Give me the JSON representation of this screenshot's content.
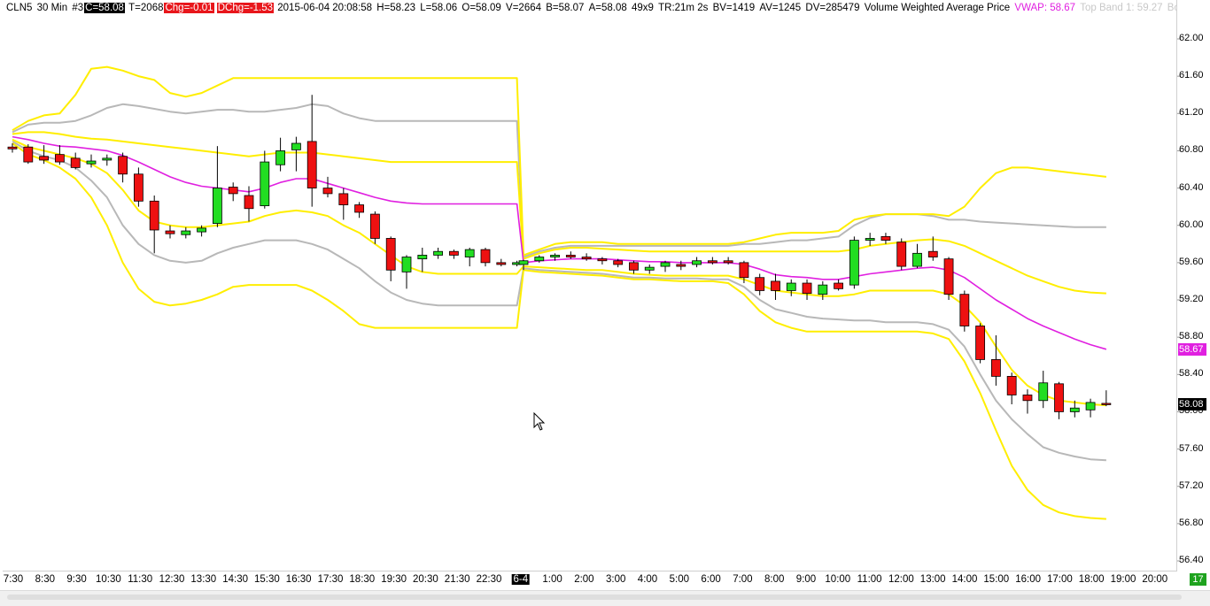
{
  "header": {
    "symbol": "CLN5",
    "interval": "30 Min",
    "instance": "#3",
    "close": "C=58.08",
    "trades": "T=2068",
    "change": "Chg=-0.01",
    "day_change": "DChg=-1.53",
    "timestamp": "2015-06-04 20:08:58",
    "high": "H=58.23",
    "low": "L=58.06",
    "open": "O=58.09",
    "volume": "V=2664",
    "bid": "B=58.07",
    "ask": "A=58.08",
    "bidask_size": "49x9",
    "time_range": "TR:21m 2s",
    "bid_volume": "BV=1419",
    "ask_volume": "AV=1245",
    "delta_volume": "DV=285479",
    "study_name": "Volume Weighted Average Price",
    "vwap": "VWAP: 58.67",
    "top_band": "Top Band 1: 59.27",
    "bottom_band": "Bottom"
  },
  "colors": {
    "up": "#22dd22",
    "down": "#ee1111",
    "vwap": "#e020e0",
    "band_yellow": "#ffee00",
    "band_gray": "#b8b8b8",
    "price_badge": "#000000",
    "vwap_badge": "#e020e0"
  },
  "chart_data": {
    "type": "candlestick",
    "title": "",
    "ylim": [
      56.3,
      62.15
    ],
    "y_ticks": [
      "62.00",
      "61.60",
      "61.20",
      "60.80",
      "60.40",
      "60.00",
      "59.60",
      "59.20",
      "58.80",
      "58.40",
      "58.00",
      "57.60",
      "57.20",
      "56.80",
      "56.40"
    ],
    "x_ticks": [
      "7:30",
      "8:30",
      "9:30",
      "10:30",
      "11:30",
      "12:30",
      "13:30",
      "14:30",
      "15:30",
      "16:30",
      "17:30",
      "18:30",
      "19:30",
      "20:30",
      "21:30",
      "22:30",
      "6-4",
      "1:00",
      "2:00",
      "3:00",
      "4:00",
      "5:00",
      "6:00",
      "7:00",
      "8:00",
      "9:00",
      "10:00",
      "11:00",
      "12:00",
      "13:00",
      "14:00",
      "15:00",
      "16:00",
      "17:00",
      "18:00",
      "19:00",
      "20:00"
    ],
    "date_tick": "6-4",
    "last_price_label": "58.08",
    "vwap_label": "58.67",
    "corner_label": "17",
    "candles": {
      "session1": [
        {
          "o": 60.84,
          "h": 60.88,
          "l": 60.78,
          "c": 60.82
        },
        {
          "o": 60.84,
          "h": 60.87,
          "l": 60.66,
          "c": 60.68
        },
        {
          "o": 60.74,
          "h": 60.86,
          "l": 60.66,
          "c": 60.7
        },
        {
          "o": 60.76,
          "h": 60.86,
          "l": 60.65,
          "c": 60.68
        },
        {
          "o": 60.72,
          "h": 60.78,
          "l": 60.6,
          "c": 60.62
        },
        {
          "o": 60.66,
          "h": 60.76,
          "l": 60.62,
          "c": 60.69
        },
        {
          "o": 60.7,
          "h": 60.76,
          "l": 60.64,
          "c": 60.72
        },
        {
          "o": 60.74,
          "h": 60.78,
          "l": 60.46,
          "c": 60.55
        },
        {
          "o": 60.55,
          "h": 60.62,
          "l": 60.2,
          "c": 60.26
        },
        {
          "o": 60.26,
          "h": 60.32,
          "l": 59.7,
          "c": 59.95
        },
        {
          "o": 59.94,
          "h": 60.0,
          "l": 59.86,
          "c": 59.91
        },
        {
          "o": 59.9,
          "h": 59.98,
          "l": 59.86,
          "c": 59.94
        },
        {
          "o": 59.93,
          "h": 60.0,
          "l": 59.88,
          "c": 59.97
        },
        {
          "o": 60.02,
          "h": 60.85,
          "l": 59.98,
          "c": 60.4
        },
        {
          "o": 60.41,
          "h": 60.46,
          "l": 60.26,
          "c": 60.34
        },
        {
          "o": 60.32,
          "h": 60.42,
          "l": 60.04,
          "c": 60.18
        },
        {
          "o": 60.21,
          "h": 60.8,
          "l": 60.18,
          "c": 60.68
        },
        {
          "o": 60.65,
          "h": 60.94,
          "l": 60.58,
          "c": 60.8
        },
        {
          "o": 60.81,
          "h": 60.95,
          "l": 60.58,
          "c": 60.88
        },
        {
          "o": 60.9,
          "h": 61.4,
          "l": 60.2,
          "c": 60.4
        },
        {
          "o": 60.4,
          "h": 60.52,
          "l": 60.3,
          "c": 60.34
        },
        {
          "o": 60.34,
          "h": 60.4,
          "l": 60.06,
          "c": 60.22
        },
        {
          "o": 60.22,
          "h": 60.25,
          "l": 60.08,
          "c": 60.14
        },
        {
          "o": 60.12,
          "h": 60.15,
          "l": 59.8,
          "c": 59.86
        },
        {
          "o": 59.86,
          "h": 59.88,
          "l": 59.4,
          "c": 59.52
        },
        {
          "o": 59.5,
          "h": 59.68,
          "l": 59.32,
          "c": 59.66
        },
        {
          "o": 59.64,
          "h": 59.76,
          "l": 59.5,
          "c": 59.68
        },
        {
          "o": 59.68,
          "h": 59.76,
          "l": 59.64,
          "c": 59.72
        },
        {
          "o": 59.72,
          "h": 59.74,
          "l": 59.64,
          "c": 59.68
        },
        {
          "o": 59.66,
          "h": 59.76,
          "l": 59.56,
          "c": 59.74
        },
        {
          "o": 59.74,
          "h": 59.76,
          "l": 59.56,
          "c": 59.6
        },
        {
          "o": 59.6,
          "h": 59.64,
          "l": 59.56,
          "c": 59.58
        },
        {
          "o": 59.58,
          "h": 59.62,
          "l": 59.56,
          "c": 59.6
        }
      ],
      "session2": [
        {
          "o": 59.58,
          "h": 59.63,
          "l": 59.52,
          "c": 59.62
        },
        {
          "o": 59.62,
          "h": 59.68,
          "l": 59.6,
          "c": 59.66
        },
        {
          "o": 59.66,
          "h": 59.7,
          "l": 59.62,
          "c": 59.68
        },
        {
          "o": 59.68,
          "h": 59.72,
          "l": 59.64,
          "c": 59.66
        },
        {
          "o": 59.66,
          "h": 59.7,
          "l": 59.62,
          "c": 59.64
        },
        {
          "o": 59.64,
          "h": 59.66,
          "l": 59.58,
          "c": 59.62
        },
        {
          "o": 59.62,
          "h": 59.64,
          "l": 59.55,
          "c": 59.58
        },
        {
          "o": 59.6,
          "h": 59.62,
          "l": 59.48,
          "c": 59.52
        },
        {
          "o": 59.52,
          "h": 59.58,
          "l": 59.48,
          "c": 59.55
        },
        {
          "o": 59.56,
          "h": 59.62,
          "l": 59.5,
          "c": 59.6
        },
        {
          "o": 59.58,
          "h": 59.62,
          "l": 59.52,
          "c": 59.56
        },
        {
          "o": 59.58,
          "h": 59.66,
          "l": 59.55,
          "c": 59.62
        },
        {
          "o": 59.62,
          "h": 59.66,
          "l": 59.58,
          "c": 59.6
        },
        {
          "o": 59.62,
          "h": 59.66,
          "l": 59.58,
          "c": 59.6
        },
        {
          "o": 59.6,
          "h": 59.62,
          "l": 59.38,
          "c": 59.44
        },
        {
          "o": 59.44,
          "h": 59.48,
          "l": 59.25,
          "c": 59.3
        },
        {
          "o": 59.4,
          "h": 59.48,
          "l": 59.2,
          "c": 59.3
        },
        {
          "o": 59.3,
          "h": 59.42,
          "l": 59.24,
          "c": 59.38
        },
        {
          "o": 59.38,
          "h": 59.42,
          "l": 59.2,
          "c": 59.27
        },
        {
          "o": 59.26,
          "h": 59.4,
          "l": 59.2,
          "c": 59.36
        },
        {
          "o": 59.38,
          "h": 59.42,
          "l": 59.3,
          "c": 59.32
        },
        {
          "o": 59.36,
          "h": 59.88,
          "l": 59.32,
          "c": 59.84
        },
        {
          "o": 59.84,
          "h": 59.92,
          "l": 59.78,
          "c": 59.86
        },
        {
          "o": 59.88,
          "h": 59.92,
          "l": 59.8,
          "c": 59.84
        },
        {
          "o": 59.82,
          "h": 59.86,
          "l": 59.52,
          "c": 59.56
        },
        {
          "o": 59.56,
          "h": 59.8,
          "l": 59.54,
          "c": 59.7
        },
        {
          "o": 59.72,
          "h": 59.88,
          "l": 59.62,
          "c": 59.66
        },
        {
          "o": 59.64,
          "h": 59.66,
          "l": 59.2,
          "c": 59.26
        },
        {
          "o": 59.26,
          "h": 59.3,
          "l": 58.86,
          "c": 58.92
        },
        {
          "o": 58.92,
          "h": 58.95,
          "l": 58.52,
          "c": 58.56
        },
        {
          "o": 58.56,
          "h": 58.82,
          "l": 58.28,
          "c": 58.38
        },
        {
          "o": 58.38,
          "h": 58.42,
          "l": 58.08,
          "c": 58.18
        },
        {
          "o": 58.18,
          "h": 58.24,
          "l": 57.98,
          "c": 58.12
        },
        {
          "o": 58.12,
          "h": 58.44,
          "l": 58.04,
          "c": 58.31
        },
        {
          "o": 58.3,
          "h": 58.32,
          "l": 57.92,
          "c": 58.0
        },
        {
          "o": 58.0,
          "h": 58.12,
          "l": 57.94,
          "c": 58.04
        },
        {
          "o": 58.02,
          "h": 58.14,
          "l": 57.94,
          "c": 58.1
        },
        {
          "o": 58.09,
          "h": 58.23,
          "l": 58.06,
          "c": 58.08
        }
      ]
    },
    "series": [
      {
        "name": "VWAP",
        "session1": [
          60.95,
          60.92,
          60.88,
          60.85,
          60.84,
          60.82,
          60.8,
          60.75,
          60.68,
          60.6,
          60.52,
          60.46,
          60.42,
          60.4,
          60.38,
          60.36,
          60.4,
          60.46,
          60.5,
          60.5,
          60.45,
          60.4,
          60.35,
          60.3,
          60.26,
          60.24,
          60.23,
          60.23,
          60.23,
          60.23,
          60.23,
          60.23,
          60.23
        ],
        "session2": [
          59.6,
          59.62,
          59.63,
          59.64,
          59.64,
          59.64,
          59.63,
          59.62,
          59.61,
          59.61,
          59.6,
          59.6,
          59.6,
          59.6,
          59.58,
          59.53,
          59.47,
          59.45,
          59.44,
          59.42,
          59.42,
          59.45,
          59.48,
          59.5,
          59.52,
          59.54,
          59.55,
          59.52,
          59.44,
          59.32,
          59.2,
          59.1,
          59.0,
          58.92,
          58.85,
          58.78,
          58.72,
          58.67
        ]
      },
      {
        "name": "Top Band 1",
        "session1": [
          60.98,
          61.0,
          61.0,
          60.98,
          60.95,
          60.93,
          60.92,
          60.9,
          60.88,
          60.86,
          60.84,
          60.82,
          60.8,
          60.78,
          60.76,
          60.74,
          60.76,
          60.78,
          60.78,
          60.78,
          60.76,
          60.74,
          60.72,
          60.7,
          60.68,
          60.68,
          60.68,
          60.68,
          60.68,
          60.68,
          60.68,
          60.68,
          60.68
        ],
        "session2": [
          59.64,
          59.7,
          59.74,
          59.76,
          59.76,
          59.75,
          59.74,
          59.73,
          59.72,
          59.72,
          59.72,
          59.72,
          59.72,
          59.72,
          59.72,
          59.72,
          59.72,
          59.72,
          59.72,
          59.72,
          59.72,
          59.74,
          59.78,
          59.8,
          59.82,
          59.84,
          59.85,
          59.83,
          59.78,
          59.7,
          59.62,
          59.54,
          59.46,
          59.4,
          59.34,
          59.3,
          59.28,
          59.27
        ]
      },
      {
        "name": "Top Band 2",
        "session1": [
          61.0,
          61.08,
          61.1,
          61.1,
          61.12,
          61.18,
          61.26,
          61.3,
          61.28,
          61.25,
          61.22,
          61.2,
          61.22,
          61.24,
          61.24,
          61.22,
          61.22,
          61.24,
          61.26,
          61.3,
          61.28,
          61.2,
          61.15,
          61.12,
          61.12,
          61.12,
          61.12,
          61.12,
          61.12,
          61.12,
          61.12,
          61.12,
          61.12
        ],
        "session2": [
          59.66,
          59.72,
          59.76,
          59.78,
          59.78,
          59.78,
          59.78,
          59.78,
          59.78,
          59.78,
          59.78,
          59.78,
          59.78,
          59.78,
          59.8,
          59.8,
          59.82,
          59.84,
          59.84,
          59.86,
          59.88,
          60.0,
          60.08,
          60.12,
          60.12,
          60.12,
          60.1,
          60.06,
          60.06,
          60.04,
          60.03,
          60.02,
          60.01,
          60.0,
          59.99,
          59.98,
          59.98,
          59.98
        ]
      },
      {
        "name": "Top Band 3",
        "session1": [
          61.02,
          61.12,
          61.18,
          61.2,
          61.4,
          61.68,
          61.7,
          61.66,
          61.6,
          61.56,
          61.42,
          61.38,
          61.42,
          61.5,
          61.58,
          61.58,
          61.58,
          61.58,
          61.58,
          61.58,
          61.58,
          61.58,
          61.58,
          61.58,
          61.58,
          61.58,
          61.58,
          61.58,
          61.58,
          61.58,
          61.58,
          61.58,
          61.58
        ],
        "session2": [
          59.68,
          59.74,
          59.8,
          59.82,
          59.82,
          59.82,
          59.8,
          59.8,
          59.8,
          59.8,
          59.8,
          59.8,
          59.8,
          59.8,
          59.82,
          59.86,
          59.9,
          59.92,
          59.92,
          59.92,
          59.94,
          60.06,
          60.1,
          60.12,
          60.12,
          60.12,
          60.12,
          60.1,
          60.2,
          60.4,
          60.56,
          60.62,
          60.62,
          60.6,
          60.58,
          60.56,
          60.54,
          60.52
        ]
      },
      {
        "name": "Bottom Band 1",
        "session1": [
          60.92,
          60.84,
          60.8,
          60.76,
          60.72,
          60.66,
          60.56,
          60.38,
          60.16,
          60.04,
          60.0,
          59.98,
          59.98,
          60.0,
          60.02,
          60.04,
          60.1,
          60.14,
          60.16,
          60.14,
          60.1,
          60.0,
          59.92,
          59.8,
          59.68,
          59.56,
          59.5,
          59.48,
          59.48,
          59.48,
          59.48,
          59.48,
          59.48
        ],
        "session2": [
          59.56,
          59.55,
          59.54,
          59.53,
          59.52,
          59.52,
          59.5,
          59.48,
          59.47,
          59.46,
          59.46,
          59.46,
          59.46,
          59.46,
          59.42,
          59.36,
          59.3,
          59.28,
          59.26,
          59.24,
          59.24,
          59.26,
          59.3,
          59.3,
          59.3,
          59.3,
          59.3,
          59.26,
          59.14,
          58.96,
          58.7,
          58.45,
          58.28,
          58.18,
          58.12,
          58.1,
          58.08,
          58.07
        ]
      },
      {
        "name": "Bottom Band 2",
        "session1": [
          60.9,
          60.8,
          60.74,
          60.7,
          60.62,
          60.48,
          60.3,
          60.0,
          59.8,
          59.68,
          59.62,
          59.6,
          59.62,
          59.7,
          59.76,
          59.8,
          59.84,
          59.84,
          59.84,
          59.8,
          59.74,
          59.64,
          59.54,
          59.4,
          59.28,
          59.2,
          59.16,
          59.14,
          59.14,
          59.14,
          59.14,
          59.14,
          59.14
        ],
        "session2": [
          59.54,
          59.52,
          59.51,
          59.5,
          59.49,
          59.48,
          59.46,
          59.44,
          59.44,
          59.43,
          59.43,
          59.43,
          59.42,
          59.42,
          59.34,
          59.2,
          59.1,
          59.06,
          59.02,
          59.0,
          58.99,
          58.98,
          58.98,
          58.96,
          58.96,
          58.96,
          58.94,
          58.88,
          58.7,
          58.4,
          58.12,
          57.92,
          57.76,
          57.62,
          57.56,
          57.52,
          57.49,
          57.48
        ]
      },
      {
        "name": "Bottom Band 3",
        "session1": [
          60.88,
          60.76,
          60.7,
          60.62,
          60.5,
          60.3,
          60.0,
          59.6,
          59.32,
          59.18,
          59.14,
          59.16,
          59.2,
          59.26,
          59.34,
          59.36,
          59.36,
          59.36,
          59.36,
          59.3,
          59.2,
          59.08,
          58.94,
          58.9,
          58.9,
          58.9,
          58.9,
          58.9,
          58.9,
          58.9,
          58.9,
          58.9,
          58.9
        ],
        "session2": [
          59.52,
          59.5,
          59.49,
          59.48,
          59.47,
          59.46,
          59.44,
          59.42,
          59.42,
          59.41,
          59.4,
          59.4,
          59.4,
          59.38,
          59.26,
          59.08,
          58.96,
          58.9,
          58.86,
          58.86,
          58.86,
          58.86,
          58.86,
          58.86,
          58.86,
          58.86,
          58.84,
          58.78,
          58.54,
          58.2,
          57.8,
          57.42,
          57.16,
          57.0,
          56.92,
          56.88,
          56.86,
          56.85
        ]
      }
    ]
  }
}
